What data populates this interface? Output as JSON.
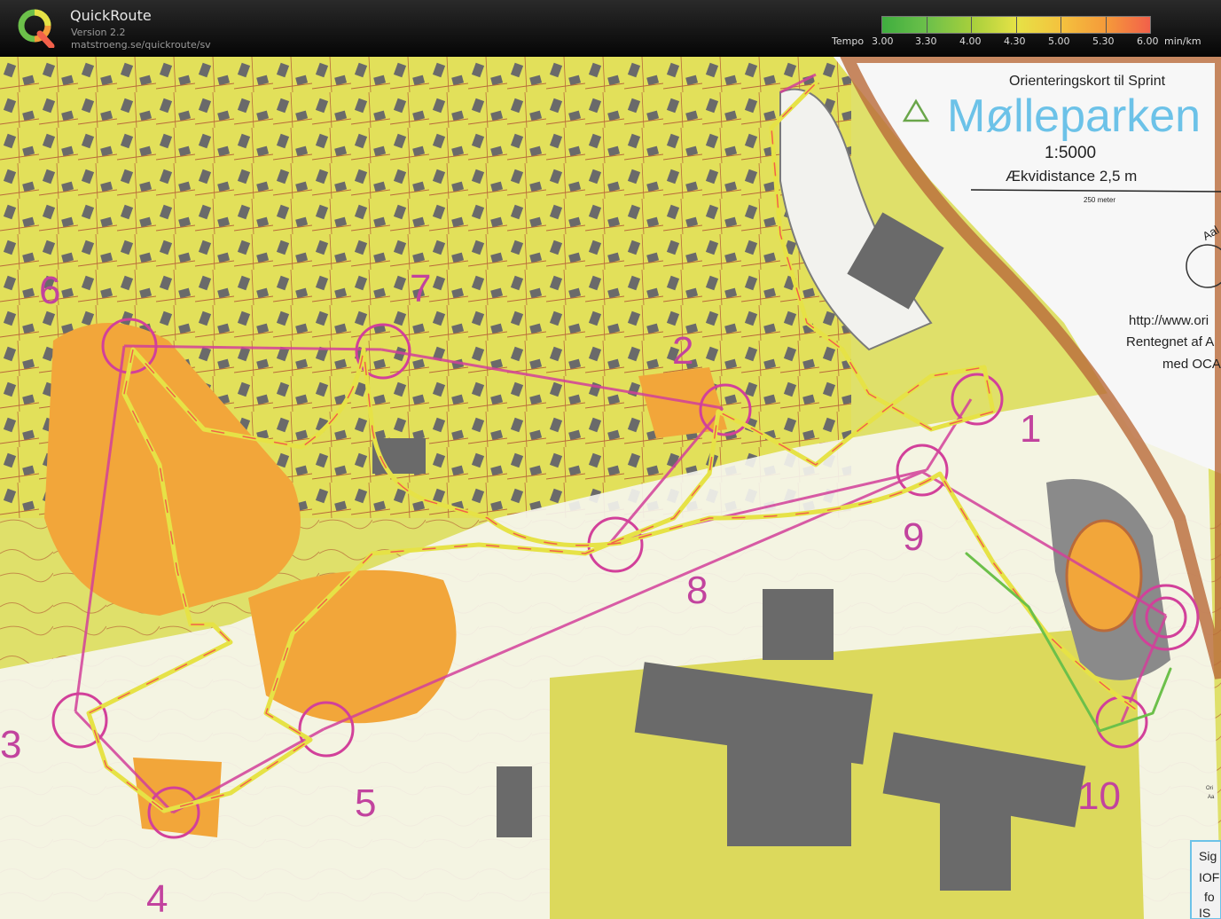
{
  "app": {
    "name": "QuickRoute",
    "version": "Version 2.2",
    "url": "matstroeng.se/quickroute/sv"
  },
  "legend": {
    "label": "Tempo",
    "ticks": [
      "3.00",
      "3.30",
      "4.00",
      "4.30",
      "5.00",
      "5.30",
      "6.00"
    ],
    "unit": "min/km",
    "colors": [
      "#3fae3f",
      "#6cc04a",
      "#a6cf3c",
      "#e6e246",
      "#f4c23e",
      "#f59a3a",
      "#f2604a"
    ]
  },
  "map": {
    "title_line": "Orienteringskort til Sprint",
    "name": "Mølleparken",
    "scale": "1:5000",
    "contour": "Ækvidistance 2,5 m",
    "scale_bar_label": "250 meter",
    "url_text": "http://www.ori",
    "credit_1": "Rentegnet af A",
    "credit_2": "med OCA",
    "logo_text": "Aal",
    "corner_1": "Sig",
    "corner_2": "IOF",
    "corner_3": "fo",
    "corner_4": "IS",
    "side_1": "Ori",
    "side_2": "Aa",
    "controls": [
      "1",
      "2",
      "3",
      "4",
      "5",
      "6",
      "7",
      "8",
      "9",
      "10"
    ]
  }
}
